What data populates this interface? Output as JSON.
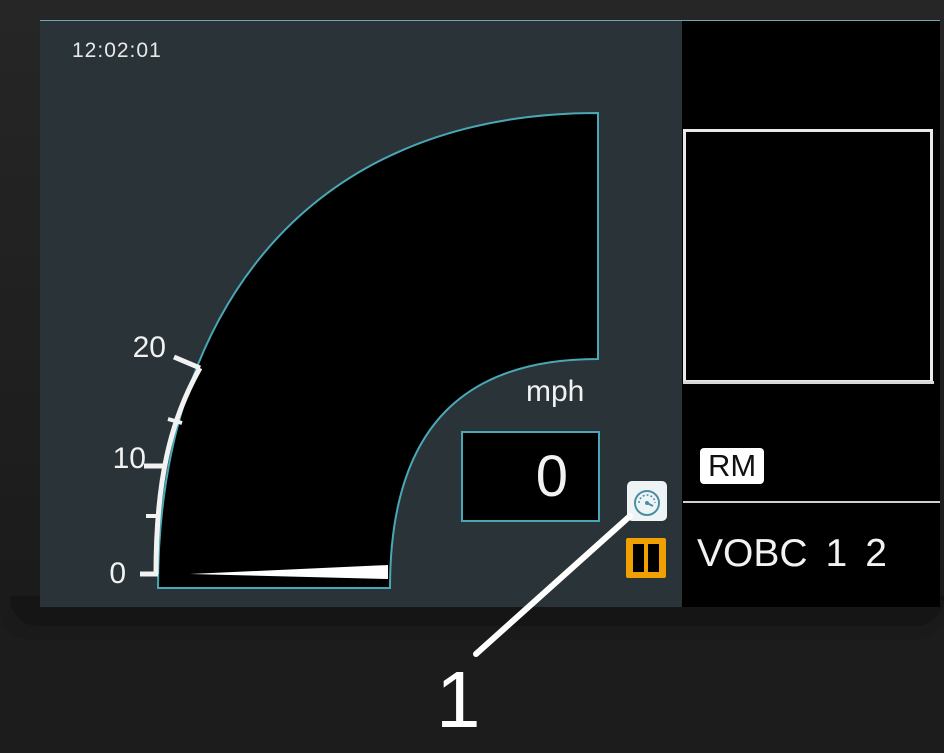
{
  "clock": "12:02:01",
  "speedometer": {
    "unit": "mph",
    "current_speed": "0",
    "current_speed_value": 0,
    "scale_max": 20,
    "scale_labels": [
      "20",
      "10",
      "0"
    ]
  },
  "mode_badge": "RM",
  "vobc": {
    "label": "VOBC",
    "units": [
      "1",
      "2"
    ]
  },
  "callout": "1",
  "icons": {
    "speed_button": "speedometer-icon",
    "pause": "pause-icon"
  },
  "colors": {
    "screen_bg": "#293338",
    "gauge_outline": "#4aa7b5",
    "pause_indicator": "#f0a000"
  }
}
